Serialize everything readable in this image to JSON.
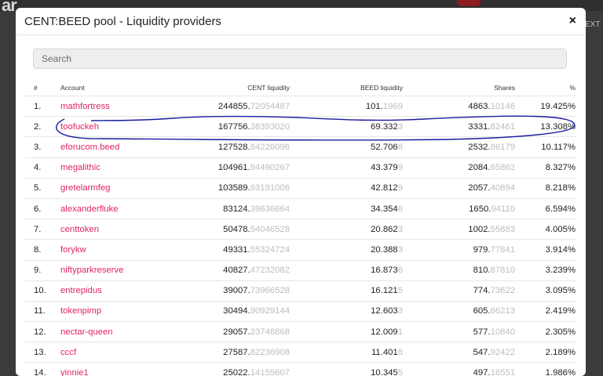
{
  "background": {
    "logo": "ar",
    "right_text": "EXT"
  },
  "modal": {
    "title": "CENT:BEED pool - Liquidity providers",
    "close_icon": "×",
    "search_placeholder": "Search"
  },
  "table": {
    "headers": [
      "#",
      "Account",
      "CENT liquidity",
      "BEED liquidity",
      "Shares",
      "%"
    ],
    "rows": [
      {
        "num": "1.",
        "account": "mathfortress",
        "cent_main": "244855.",
        "cent_dec": "72054487",
        "beed_main": "101.",
        "beed_dec": "1969",
        "shares_main": "4863.",
        "shares_dec": "10146",
        "pct": "19.425%"
      },
      {
        "num": "2.",
        "account": "toofuckeh",
        "cent_main": "167756.",
        "cent_dec": "38393020",
        "beed_main": "69.332",
        "beed_dec": "3",
        "shares_main": "3331.",
        "shares_dec": "82461",
        "pct": "13.308%"
      },
      {
        "num": "3.",
        "account": "eforucom.beed",
        "cent_main": "127528.",
        "cent_dec": "84226096",
        "beed_main": "52.706",
        "beed_dec": "6",
        "shares_main": "2532.",
        "shares_dec": "86179",
        "pct": "10.117%"
      },
      {
        "num": "4.",
        "account": "megalithic",
        "cent_main": "104961.",
        "cent_dec": "94490267",
        "beed_main": "43.379",
        "beed_dec": "9",
        "shares_main": "2084.",
        "shares_dec": "65862",
        "pct": "8.327%"
      },
      {
        "num": "5.",
        "account": "gretelarmfeg",
        "cent_main": "103589.",
        "cent_dec": "93191006",
        "beed_main": "42.812",
        "beed_dec": "9",
        "shares_main": "2057.",
        "shares_dec": "40894",
        "pct": "8.218%"
      },
      {
        "num": "6.",
        "account": "alexanderfluke",
        "cent_main": "83124.",
        "cent_dec": "39636664",
        "beed_main": "34.354",
        "beed_dec": "6",
        "shares_main": "1650.",
        "shares_dec": "94110",
        "pct": "6.594%"
      },
      {
        "num": "7.",
        "account": "centtoken",
        "cent_main": "50478.",
        "cent_dec": "54046528",
        "beed_main": "20.862",
        "beed_dec": "3",
        "shares_main": "1002.",
        "shares_dec": "55883",
        "pct": "4.005%"
      },
      {
        "num": "8.",
        "account": "forykw",
        "cent_main": "49331.",
        "cent_dec": "55324724",
        "beed_main": "20.388",
        "beed_dec": "3",
        "shares_main": "979.",
        "shares_dec": "77841",
        "pct": "3.914%"
      },
      {
        "num": "9.",
        "account": "niftyparkreserve",
        "cent_main": "40827.",
        "cent_dec": "47232082",
        "beed_main": "16.873",
        "beed_dec": "6",
        "shares_main": "810.",
        "shares_dec": "87810",
        "pct": "3.239%"
      },
      {
        "num": "10.",
        "account": "entrepidus",
        "cent_main": "39007.",
        "cent_dec": "73966528",
        "beed_main": "16.121",
        "beed_dec": "5",
        "shares_main": "774.",
        "shares_dec": "73622",
        "pct": "3.095%"
      },
      {
        "num": "11.",
        "account": "tokenpimp",
        "cent_main": "30494.",
        "cent_dec": "90929144",
        "beed_main": "12.603",
        "beed_dec": "3",
        "shares_main": "605.",
        "shares_dec": "66213",
        "pct": "2.419%"
      },
      {
        "num": "12.",
        "account": "nectar-queen",
        "cent_main": "29057.",
        "cent_dec": "23746868",
        "beed_main": "12.009",
        "beed_dec": "1",
        "shares_main": "577.",
        "shares_dec": "10840",
        "pct": "2.305%"
      },
      {
        "num": "13.",
        "account": "cccf",
        "cent_main": "27587.",
        "cent_dec": "82236908",
        "beed_main": "11.401",
        "beed_dec": "8",
        "shares_main": "547.",
        "shares_dec": "92422",
        "pct": "2.189%"
      },
      {
        "num": "14.",
        "account": "yinnie1",
        "cent_main": "25022.",
        "cent_dec": "14155607",
        "beed_main": "10.345",
        "beed_dec": "5",
        "shares_main": "497.",
        "shares_dec": "16551",
        "pct": "1.986%"
      }
    ]
  },
  "colors": {
    "account_link": "#e0245e",
    "annotation_ink": "#1a1aa0",
    "dim_decimals": "#bdbdbd"
  }
}
